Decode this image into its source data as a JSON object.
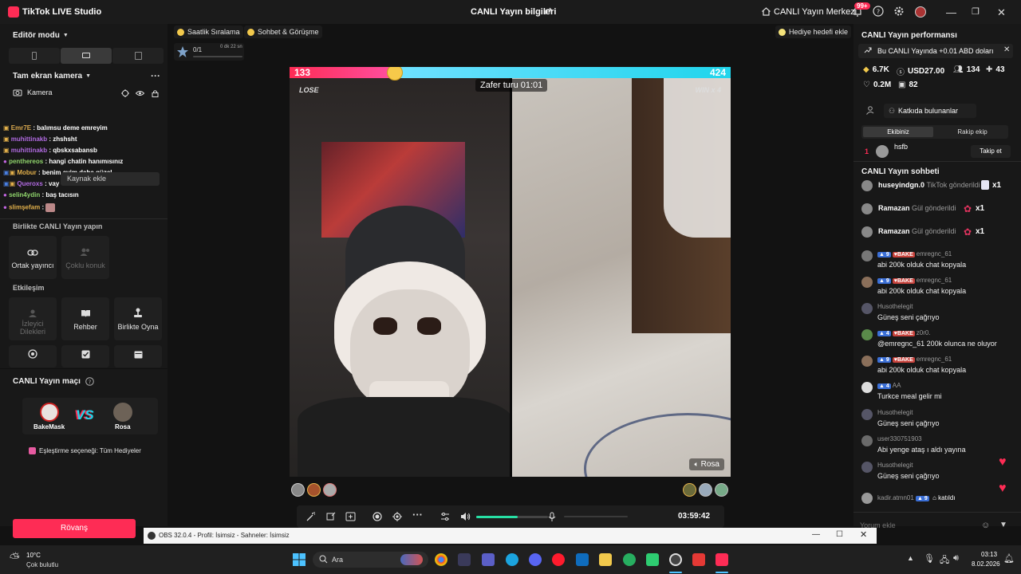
{
  "titlebar": {
    "app_name": "TikTok LIVE Studio",
    "center_title": "CANLI Yayın bilgileri",
    "center_link": "CANLI Yayın Merkezi",
    "notif_count": "99+"
  },
  "left_panel": {
    "editor_mode": "Editör modu",
    "scene": "Tam ekran kamera",
    "camera_label": "Kamera",
    "add_source_tooltip": "Kaynak ekle",
    "chat": [
      {
        "user": "Emr7E",
        "text": ": balımsu deme emreyim",
        "color": "#d9a84e"
      },
      {
        "user": "muhittinakb",
        "text": ": zhshsht",
        "color": "#b06ae0"
      },
      {
        "user": "muhittinakb",
        "text": ": qbskxsabansb",
        "color": "#b06ae0"
      },
      {
        "user": "penthereos",
        "text": ": hangi chatin hanımısınız",
        "color": "#8fd36b"
      },
      {
        "user": "Mobur",
        "text": ": benim evim daha güzel",
        "color": "#e3b14b"
      },
      {
        "user": "Queroxs",
        "text": ": vay",
        "color": "#b06ae0"
      },
      {
        "user": "selin4ydin",
        "text": ": baş tacısın",
        "color": "#8fd36b"
      },
      {
        "user": "slimşefam",
        "text": ":",
        "color": "#e3b14b"
      }
    ],
    "collab_section": "Birlikte CANLI Yayın yapın",
    "collab_tiles": [
      "Ortak yayıncı",
      "Çoklu konuk"
    ],
    "interaction_section": "Etkileşim",
    "interaction_tiles": [
      "İzleyici Dilekleri",
      "Rehber",
      "Birlikte Oyna"
    ],
    "match_section": "CANLI Yayın maçı",
    "player1": "BakeMask",
    "player2": "Rosa",
    "match_option": "Eşleştirme seçeneği: Tüm Hediyeler",
    "rematch_button": "Rövanş"
  },
  "top_tabs": {
    "hourly": "Saatlik Sıralama",
    "chat_meet": "Sohbet & Görüşme",
    "gift_goal": "Hediye hedefi ekle",
    "mini_counter": "0/1",
    "mini_timer": "0 dk 22 sn"
  },
  "stage": {
    "score_left": "133",
    "score_right": "424",
    "score_fraction_left": 0.239,
    "timer": "Zafer turu 01:01",
    "lose_label": "LOSE",
    "win_label": "WIN x 4",
    "right_name": "Rosa"
  },
  "toolbar": {
    "duration": "03:59:42",
    "volume_level": 0.58
  },
  "right_panel": {
    "performance_title": "CANLI Yayın performansı",
    "earnings_banner": "Bu CANLI Yayında +0.01 ABD doları",
    "stats": {
      "coins": "6.7K",
      "usd": "USD27.00",
      "viewers": "134",
      "new": "43",
      "likes": "0.2M",
      "gifts": "82"
    },
    "contributors_button": "Katkıda bulunanlar",
    "tab_team": "Ekibiniz",
    "tab_rival": "Rakip ekip",
    "top_rank": "1",
    "top_user": "hsfb",
    "follow_button": "Takip et",
    "chat_title": "CANLI Yayın sohbeti",
    "gifts": [
      {
        "user": "huseyindgn.0",
        "action": "TikTok gönderildi",
        "count": "x1"
      },
      {
        "user": "Ramazan",
        "action": "Gül gönderildi",
        "count": "x1"
      },
      {
        "user": "Ramazan",
        "action": "Gül gönderildi",
        "count": "x1"
      }
    ],
    "messages": [
      {
        "name": "emregnc_61",
        "text": "abi 200k olduk chat kopyala",
        "lvl": "9",
        "tag": "BAKE"
      },
      {
        "name": "emregnc_61",
        "text": "abi 200k olduk chat kopyala",
        "lvl": "9",
        "tag": "BAKE"
      },
      {
        "name": "Husothelegit",
        "text": "Güneş seni çağrıyo",
        "lvl": "",
        "tag": ""
      },
      {
        "name": "z0r0.",
        "text": "@emregnc_61 200k olunca ne oluyor",
        "lvl": "4",
        "tag": "BAKE"
      },
      {
        "name": "emregnc_61",
        "text": "abi 200k olduk chat kopyala",
        "lvl": "9",
        "tag": "BAKE"
      },
      {
        "name": "AA",
        "text": "Turkce meal gelir mi",
        "lvl": "4",
        "tag": ""
      },
      {
        "name": "Husothelegit",
        "text": "Güneş seni çağrıyo",
        "lvl": "",
        "tag": ""
      },
      {
        "name": "user330751903",
        "text": "Abi yenge ataş ı aldı yayına",
        "lvl": "",
        "tag": ""
      },
      {
        "name": "Husothelegit",
        "text": "Güneş seni çağrıyo",
        "lvl": "",
        "tag": ""
      }
    ],
    "join": {
      "user": "kadir.atmn01",
      "lvl": "9",
      "text": "katıldı"
    },
    "comment_placeholder": "Yorum ekle"
  },
  "obs": {
    "title": "OBS 32.0.4 - Profil: İsimsiz - Sahneler: İsimsiz"
  },
  "taskbar": {
    "temp": "10°C",
    "weather": "Çok bulutlu",
    "search": "Ara",
    "time": "03:13",
    "date": "8.02.2026"
  },
  "colors": {
    "accent": "#fe2c55",
    "cyan": "#20d5ec"
  }
}
